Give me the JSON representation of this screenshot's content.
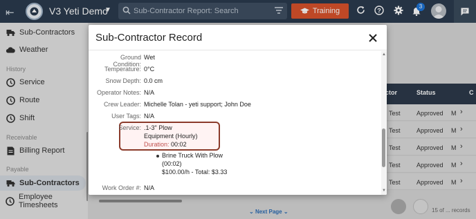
{
  "app": {
    "title": "V3 Yeti Demo"
  },
  "search": {
    "placeholder": "Sub-Contractor Report: Search"
  },
  "toolbar": {
    "training_label": "Training",
    "notification_count": "3"
  },
  "sidebar": {
    "items_top": [
      {
        "label": "Sub-Contractors",
        "icon": "truck-icon"
      },
      {
        "label": "Weather",
        "icon": "cloud-icon"
      }
    ],
    "history_label": "History",
    "history_items": [
      {
        "label": "Service",
        "icon": "service-icon"
      },
      {
        "label": "Route",
        "icon": "route-icon"
      },
      {
        "label": "Shift",
        "icon": "shift-icon"
      }
    ],
    "receivable_label": "Receivable",
    "receivable_items": [
      {
        "label": "Billing Report",
        "icon": "billing-icon"
      }
    ],
    "payable_label": "Payable",
    "payable_items": [
      {
        "label": "Sub-Contractors",
        "icon": "truck-icon",
        "active": true
      },
      {
        "label": "Employee Timesheets",
        "icon": "timesheet-icon"
      }
    ]
  },
  "background_table": {
    "headers": [
      "ctor",
      "Status",
      "C"
    ],
    "rows": [
      {
        "c1": "Test",
        "status": "Approved",
        "c3": "M"
      },
      {
        "c1": "Test",
        "status": "Approved",
        "c3": "M"
      },
      {
        "c1": "Test",
        "status": "Approved",
        "c3": "M"
      },
      {
        "c1": "Test",
        "status": "Approved",
        "c3": "M"
      },
      {
        "c1": "Test",
        "status": "Approved",
        "c3": "M"
      }
    ],
    "next_page_label": "Next Page",
    "records_text": "15 of ... records"
  },
  "modal": {
    "title": "Sub-Contractor Record",
    "fields": [
      {
        "label": "Ground Condition:",
        "value": "Wet"
      },
      {
        "label": "Temperature:",
        "value": "0°C"
      },
      {
        "label": "Snow Depth:",
        "value": "0.0 cm"
      },
      {
        "label": "Operator Notes:",
        "value": "N/A"
      },
      {
        "label": "Crew Leader:",
        "value": "Michelle Tolan - yeti support; John Doe"
      },
      {
        "label": "User Tags:",
        "value": "N/A"
      }
    ],
    "service": {
      "label": "Service:",
      "name": ".1-3\" Plow",
      "equipment": "Equipment (Hourly)",
      "duration_label": "Duration:",
      "duration_value": "00:02"
    },
    "equipment_item": {
      "name": "Brine Truck With Plow",
      "duration": "(00:02)",
      "rate": "$100.00/h - Total: $3.33"
    },
    "work_order": {
      "label": "Work Order #:",
      "value": "N/A"
    }
  },
  "colors": {
    "topbar": "#2b3b4e",
    "training": "#d9532c",
    "highlight_border": "#8b3a2a"
  }
}
